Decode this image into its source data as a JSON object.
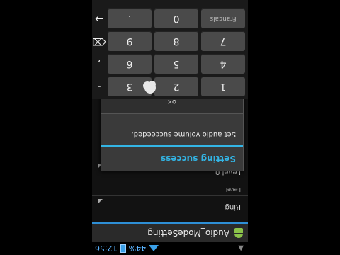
{
  "status_bar": {
    "time": "12:56",
    "battery": "44%",
    "left_icon": "android-debug-icon"
  },
  "title_bar": {
    "app_title": "Audio_ModeSetting",
    "icon": "android-icon"
  },
  "list": {
    "item_ring": "Ring",
    "section_level": "Level",
    "item_level0": "Level 0"
  },
  "dialog": {
    "title": "Setting success",
    "message": "Set audio volume succeeded.",
    "ok_label": "ok"
  },
  "keyboard": {
    "row1": [
      "1",
      "2",
      "3"
    ],
    "row2": [
      "4",
      "5",
      "6"
    ],
    "row3": [
      "7",
      "8",
      "9"
    ],
    "row4": [
      "Francais",
      "0",
      "."
    ],
    "side_left": [
      "-",
      ",",
      "⌫",
      "→"
    ],
    "accent_color": "#33b5e5"
  }
}
